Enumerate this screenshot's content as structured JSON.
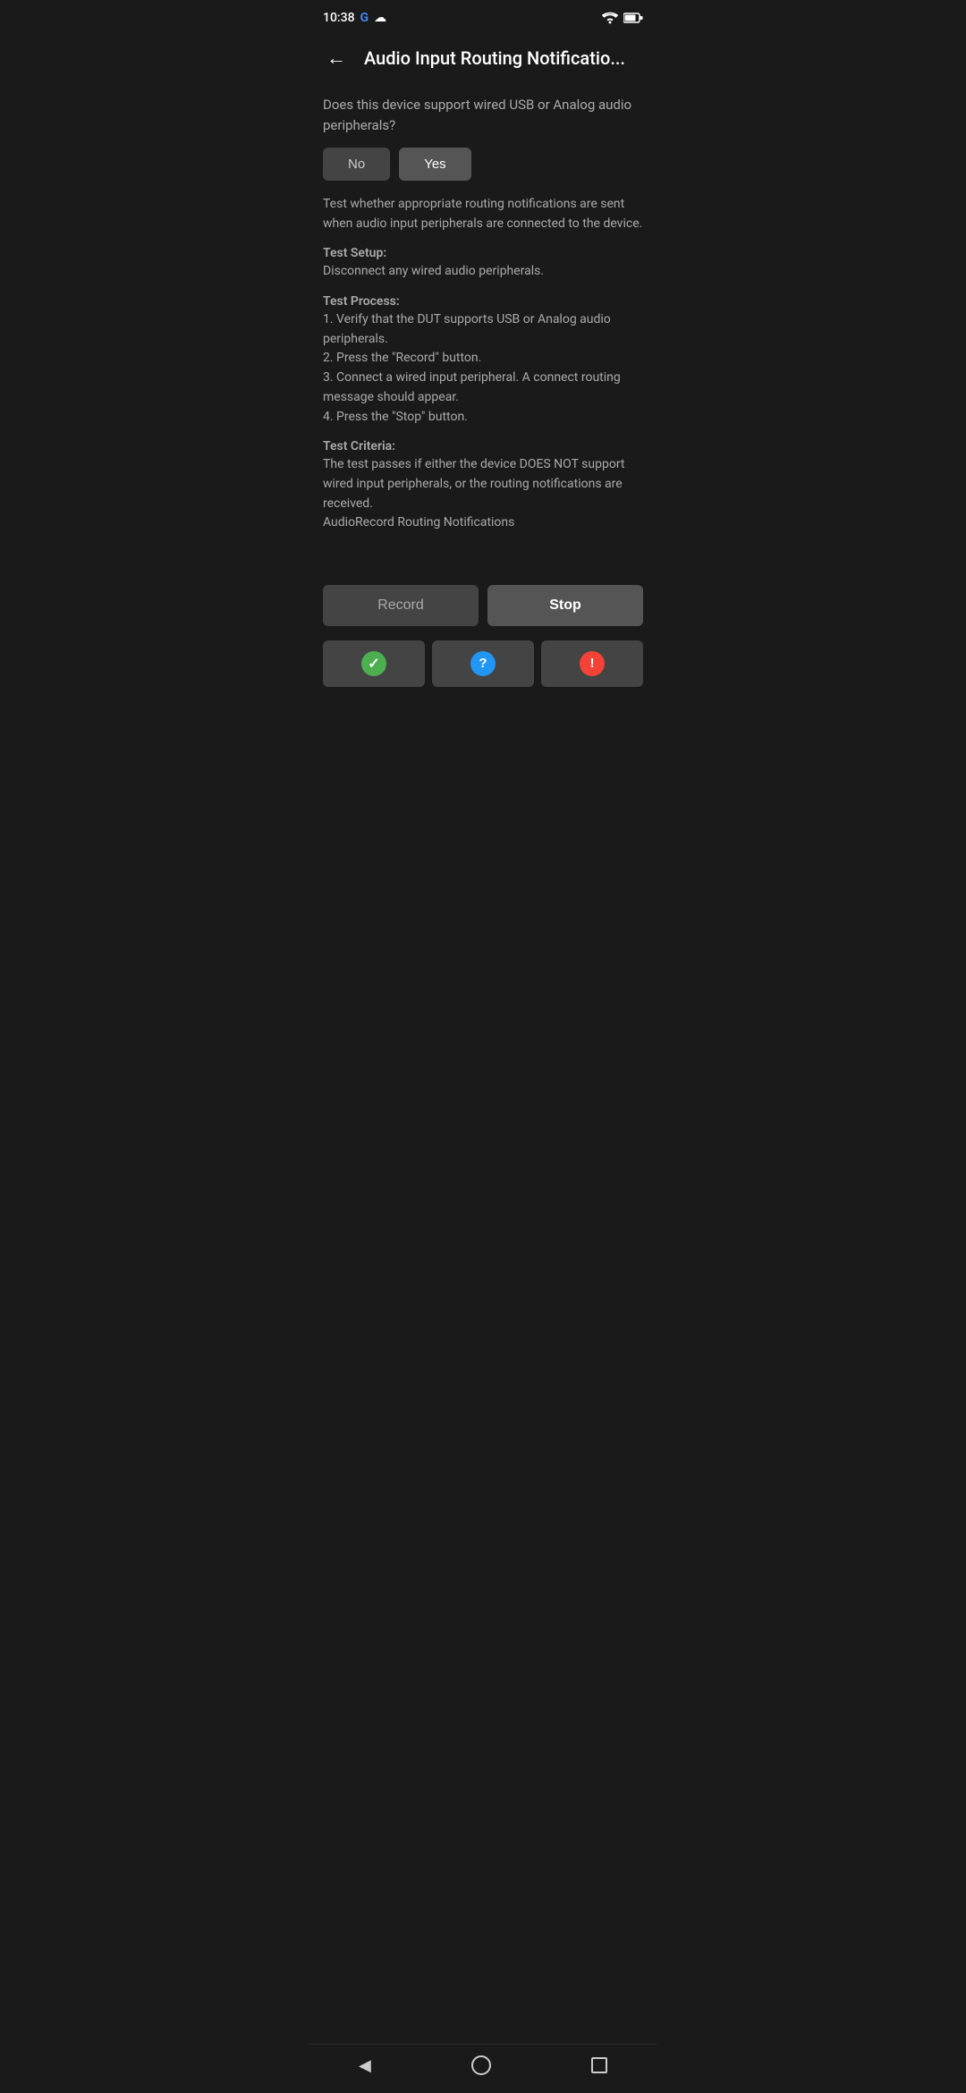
{
  "statusBar": {
    "time": "10:38",
    "googleLabel": "G",
    "cloudSymbol": "☁",
    "wifiSymbol": "▾",
    "batterySymbol": "🔋"
  },
  "header": {
    "backLabel": "←",
    "title": "Audio Input Routing Notificatio..."
  },
  "question": {
    "text": "Does this device support wired USB or Analog audio peripherals?",
    "noLabel": "No",
    "yesLabel": "Yes"
  },
  "description": "Test whether appropriate routing notifications are sent when audio input peripherals are connected to the device.",
  "setup": {
    "title": "Test Setup:",
    "body": "Disconnect any wired audio peripherals."
  },
  "process": {
    "title": "Test Process:",
    "body": "1. Verify that the DUT supports USB or Analog audio peripherals.\n2. Press the \"Record\" button.\n3. Connect a wired input peripheral. A connect routing message should appear.\n4. Press the \"Stop\" button."
  },
  "criteria": {
    "title": "Test Criteria:",
    "body": "The test passes if either the device DOES NOT support wired input peripherals, or the routing notifications are received.\nAudioRecord Routing Notifications"
  },
  "actions": {
    "recordLabel": "Record",
    "stopLabel": "Stop"
  },
  "results": {
    "passIcon": "✓",
    "questionIcon": "?",
    "failIcon": "!"
  },
  "navBar": {
    "backSymbol": "◀",
    "homeSymbol": "",
    "recentSymbol": ""
  }
}
